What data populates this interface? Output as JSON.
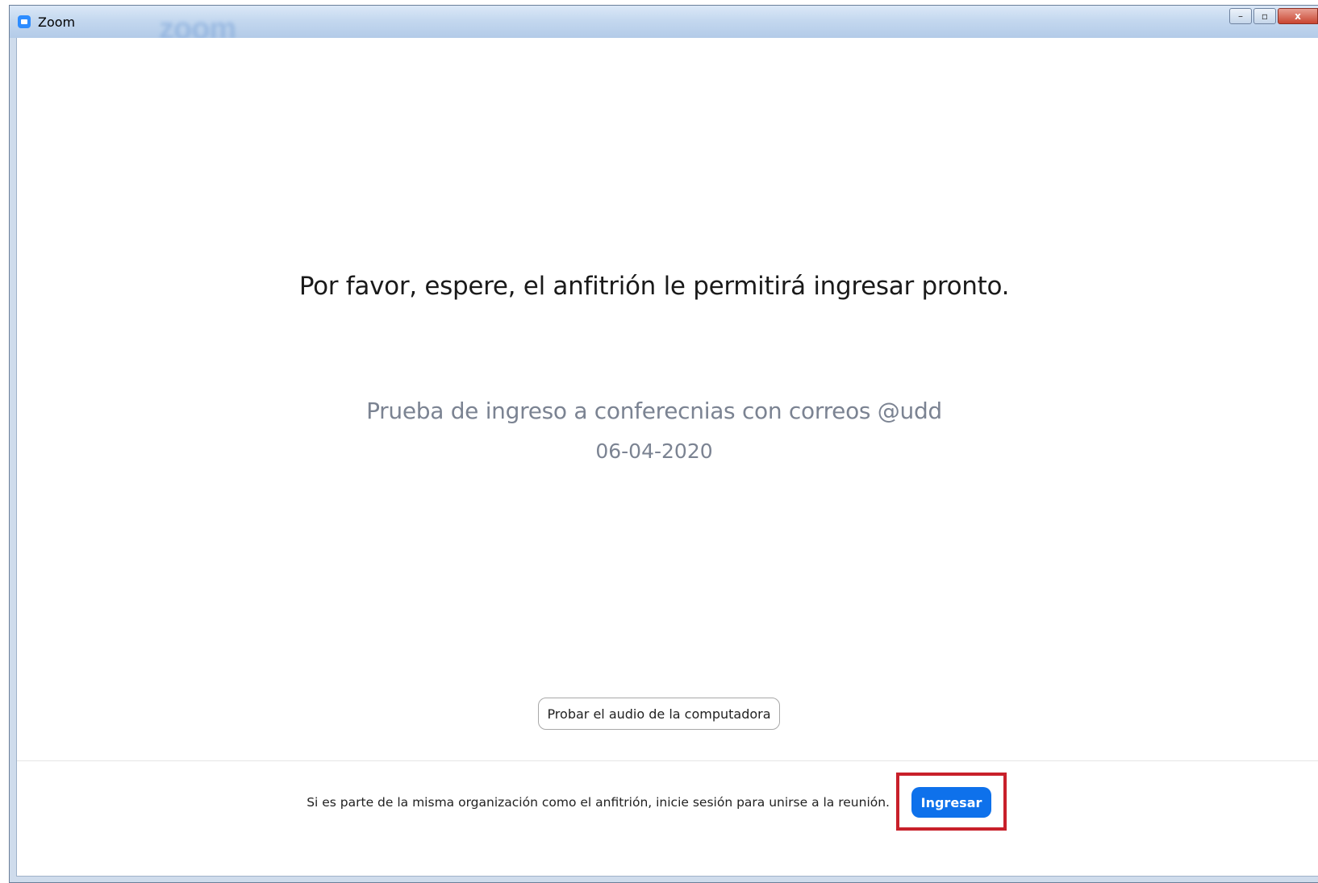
{
  "window": {
    "title": "Zoom",
    "watermark": "zoom",
    "controls": {
      "minimize": "–",
      "maximize": "▫",
      "close": "x"
    }
  },
  "waiting_room": {
    "message": "Por favor, espere, el anfitrión le permitirá ingresar pronto.",
    "meeting_topic": "Prueba de ingreso a conferecnias con correos @udd",
    "meeting_date": "06-04-2020",
    "test_audio_label": "Probar el audio de la computadora"
  },
  "footer": {
    "signin_prompt": "Si es parte de la misma organización como el anfitrión, inicie sesión para unirse a la reunión.",
    "signin_button_label": "Ingresar"
  },
  "colors": {
    "accent": "#0e71eb",
    "highlight": "#c8202a",
    "secondary_text": "#7b8392"
  },
  "icons": {
    "app": "zoom-logo-icon"
  }
}
